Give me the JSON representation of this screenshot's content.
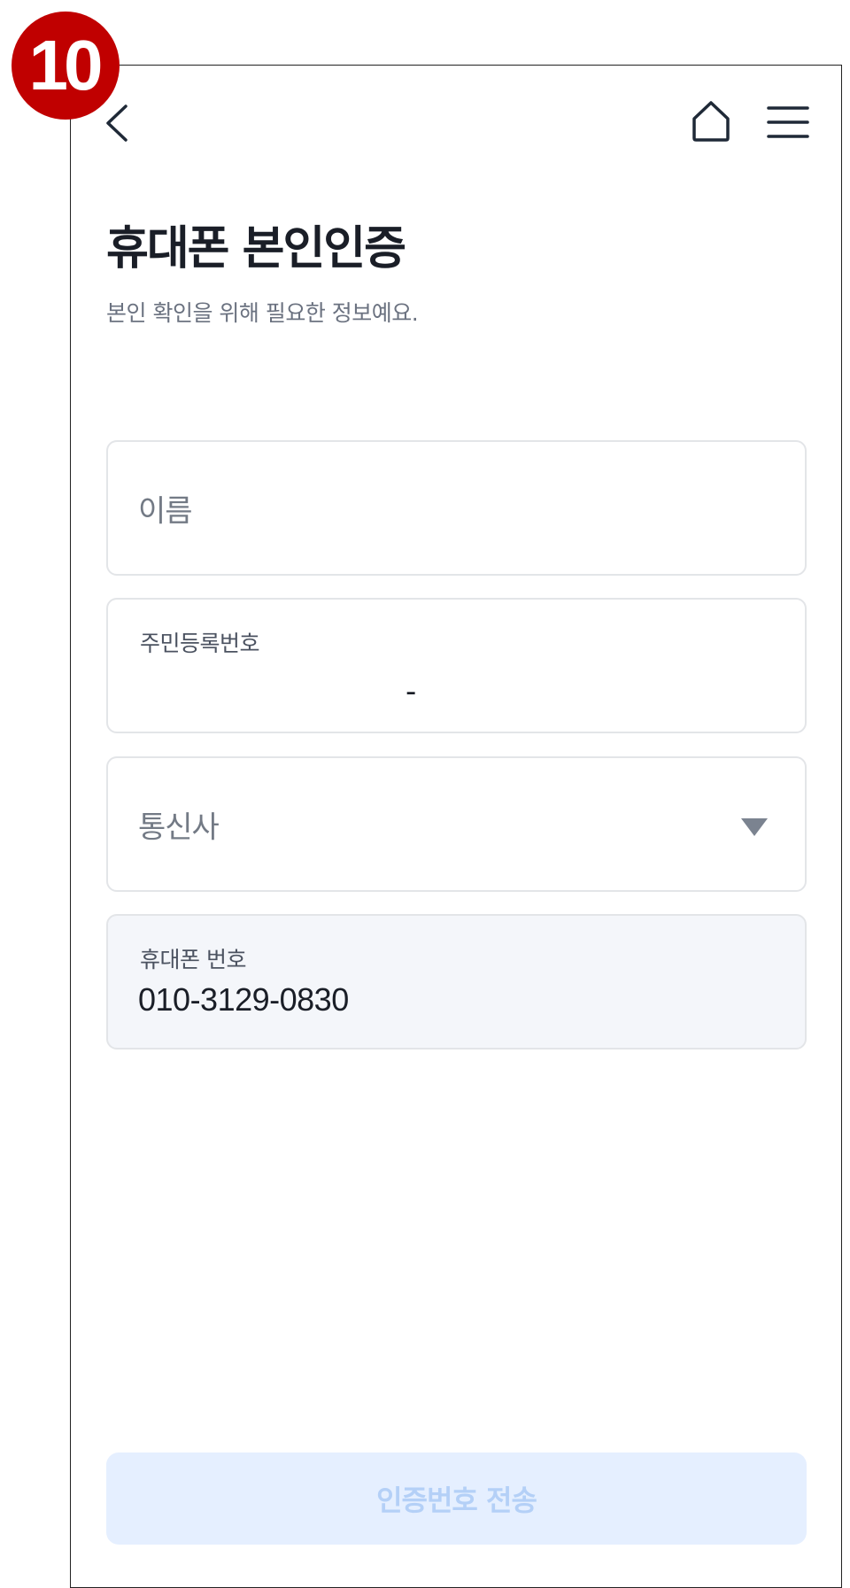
{
  "step_badge": "10",
  "header": {
    "back_icon": "chevron-left-icon",
    "home_icon": "home-icon",
    "menu_icon": "hamburger-menu-icon"
  },
  "page": {
    "title": "휴대폰 본인인증",
    "subtitle": "본인 확인을 위해 필요한 정보예요."
  },
  "form": {
    "name_field": {
      "placeholder": "이름"
    },
    "rrn_field": {
      "label": "주민등록번호",
      "separator": "-"
    },
    "carrier_field": {
      "placeholder": "통신사",
      "icon": "dropdown-arrow-icon"
    },
    "phone_field": {
      "label": "휴대폰 번호",
      "value": "010-3129-0830"
    }
  },
  "submit": {
    "label": "인증번호 전송",
    "enabled": false
  },
  "colors": {
    "badge": "#c00000",
    "title": "#1a1e27",
    "submit_bg_disabled": "#e5efff",
    "submit_text_disabled": "#b4d0f7"
  }
}
